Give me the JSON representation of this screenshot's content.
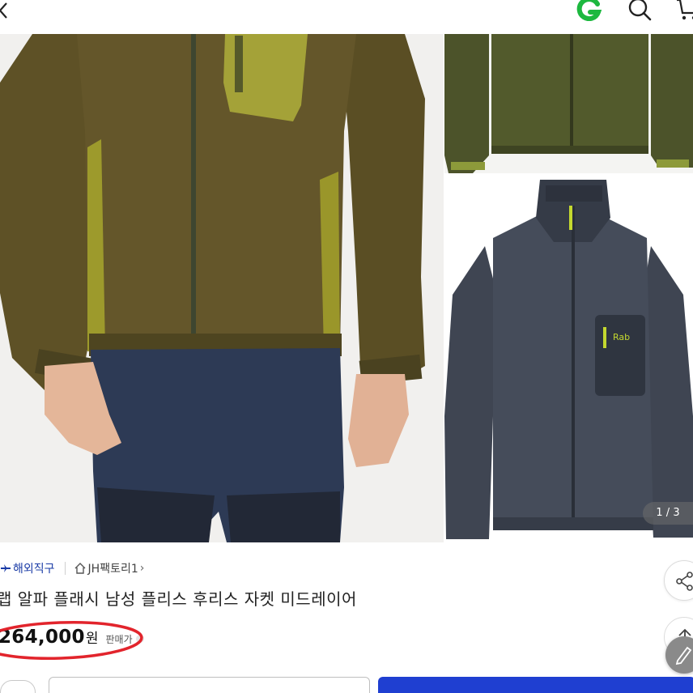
{
  "header": {
    "back_icon": "chevron-left-icon",
    "g_icon": "green-g-icon",
    "search_icon": "search-icon",
    "cart_icon": "cart-icon",
    "accent": "#1db83f"
  },
  "gallery": {
    "page_indicator": "1 / 3",
    "main_jacket_color": "#5b4f22",
    "main_accent_color": "#a6a030",
    "side_top_color": "#4e552a",
    "side_bottom_color": "#3e4450"
  },
  "product": {
    "badge": "해외직구",
    "seller": "JH팩토리1",
    "seller_chevron": "›",
    "title": "랩 알파 플래시 남성 플리스 후리스 자켓 미드레이어",
    "price": "264,000",
    "price_unit": "원",
    "price_tag": "판매가",
    "highlight_color": "#e2242c"
  },
  "actions": {
    "share_icon": "share-icon",
    "top_icon": "arrow-up-icon",
    "edit_icon": "pencil-icon"
  },
  "bottom": {
    "primary_color": "#1f3fd1"
  }
}
